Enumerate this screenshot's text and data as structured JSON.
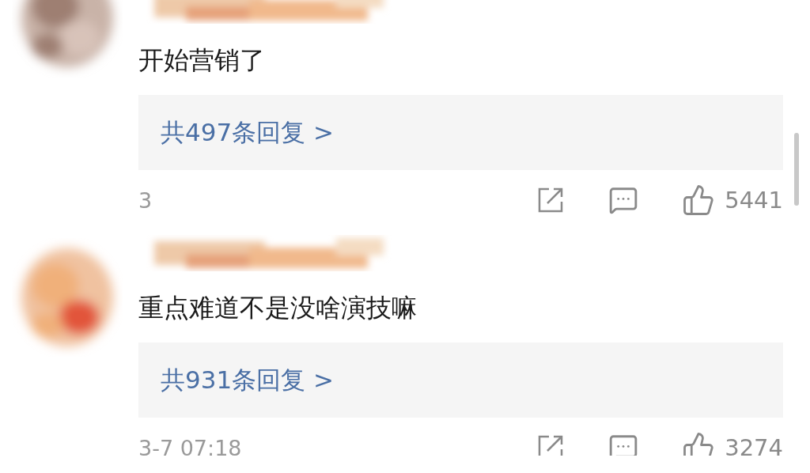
{
  "comments": [
    {
      "date": "3",
      "text": "开始营销了",
      "replies": "共497条回复 >",
      "likes": "5441"
    },
    {
      "date": "3-7 07:18",
      "text": "重点难道不是没啥演技嘛",
      "replies": "共931条回复 >",
      "likes": "3274"
    }
  ]
}
